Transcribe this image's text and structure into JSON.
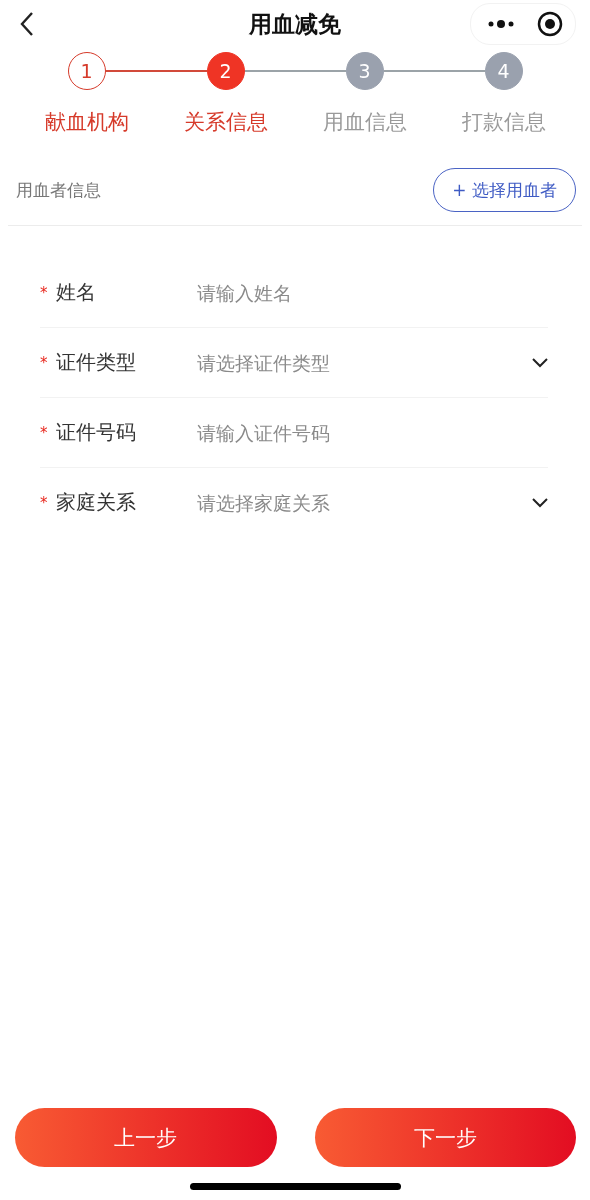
{
  "nav": {
    "title": "用血减免"
  },
  "steps": [
    {
      "number": "1",
      "label": "献血机构",
      "completed": true,
      "selected": false
    },
    {
      "number": "2",
      "label": "关系信息",
      "completed": false,
      "selected": true
    },
    {
      "number": "3",
      "label": "用血信息",
      "completed": false,
      "selected": false
    },
    {
      "number": "4",
      "label": "打款信息",
      "completed": false,
      "selected": false
    }
  ],
  "section": {
    "title": "用血者信息",
    "action": "+ 选择用血者"
  },
  "fields": [
    {
      "kind": "input",
      "marker": "*",
      "label": "姓名",
      "placeholder": "请输入姓名"
    },
    {
      "kind": "select",
      "marker": "*",
      "label": "证件类型",
      "placeholder": "请选择证件类型"
    },
    {
      "kind": "input",
      "marker": "*",
      "label": "证件号码",
      "placeholder": "请输入证件号码"
    },
    {
      "kind": "select",
      "marker": "*",
      "label": "家庭关系",
      "placeholder": "请选择家庭关系"
    }
  ],
  "buttons": [
    "上一步",
    "下一步"
  ]
}
